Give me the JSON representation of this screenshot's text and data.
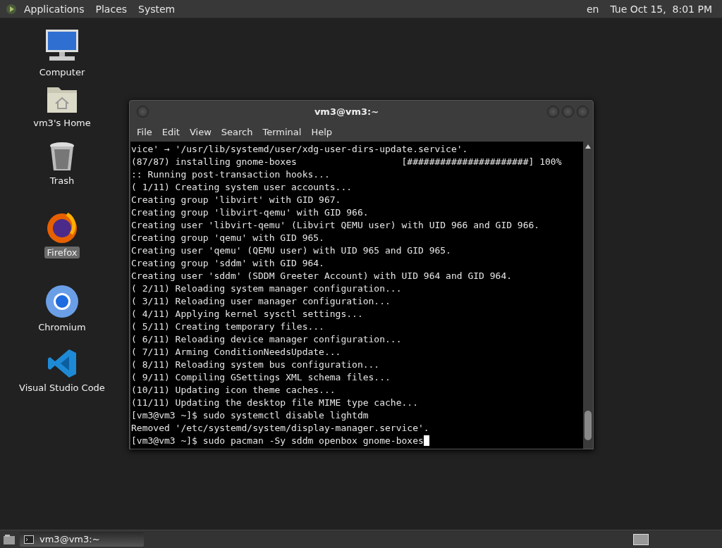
{
  "top_panel": {
    "menus": [
      "Applications",
      "Places",
      "System"
    ],
    "keyboard_layout": "en",
    "clock": "Tue Oct 15,  8:01 PM"
  },
  "desktop_icons": [
    {
      "kind": "computer",
      "label": "Computer",
      "selected": false
    },
    {
      "kind": "home",
      "label": "vm3's Home",
      "selected": false
    },
    {
      "kind": "trash",
      "label": "Trash",
      "selected": false
    },
    {
      "kind": "firefox",
      "label": "Firefox",
      "selected": true
    },
    {
      "kind": "chromium",
      "label": "Chromium",
      "selected": false
    },
    {
      "kind": "vscode",
      "label": "Visual Studio Code",
      "selected": false
    }
  ],
  "terminal": {
    "title": "vm3@vm3:~",
    "menus": [
      "File",
      "Edit",
      "View",
      "Search",
      "Terminal",
      "Help"
    ],
    "cursor": true,
    "lines": [
      "vice' → '/usr/lib/systemd/user/xdg-user-dirs-update.service'.",
      "(87/87) installing gnome-boxes                   [######################] 100%",
      ":: Running post-transaction hooks...",
      "( 1/11) Creating system user accounts...",
      "Creating group 'libvirt' with GID 967.",
      "Creating group 'libvirt-qemu' with GID 966.",
      "Creating user 'libvirt-qemu' (Libvirt QEMU user) with UID 966 and GID 966.",
      "Creating group 'qemu' with GID 965.",
      "Creating user 'qemu' (QEMU user) with UID 965 and GID 965.",
      "Creating group 'sddm' with GID 964.",
      "Creating user 'sddm' (SDDM Greeter Account) with UID 964 and GID 964.",
      "( 2/11) Reloading system manager configuration...",
      "( 3/11) Reloading user manager configuration...",
      "( 4/11) Applying kernel sysctl settings...",
      "( 5/11) Creating temporary files...",
      "( 6/11) Reloading device manager configuration...",
      "( 7/11) Arming ConditionNeedsUpdate...",
      "( 8/11) Reloading system bus configuration...",
      "( 9/11) Compiling GSettings XML schema files...",
      "(10/11) Updating icon theme caches...",
      "(11/11) Updating the desktop file MIME type cache...",
      "[vm3@vm3 ~]$ sudo systemctl disable lightdm",
      "Removed '/etc/systemd/system/display-manager.service'.",
      "[vm3@vm3 ~]$ sudo pacman -Sy sddm openbox gnome-boxes"
    ]
  },
  "taskbar": {
    "tasks": [
      {
        "label": "vm3@vm3:~",
        "selected": true
      }
    ]
  }
}
